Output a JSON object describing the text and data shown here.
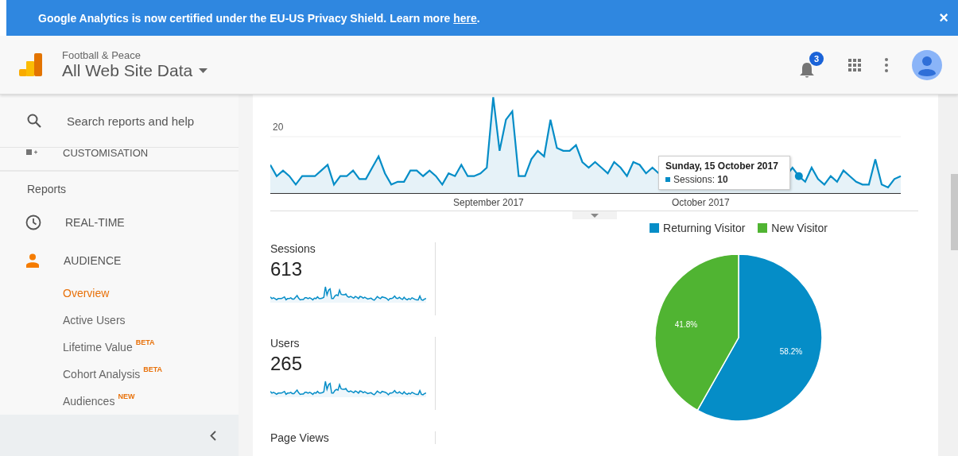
{
  "banner": {
    "message": "Google Analytics is now certified under the EU-US Privacy Shield. Learn more ",
    "link": "here",
    "end": ".",
    "close": "×"
  },
  "header": {
    "account": "Football & Peace",
    "view": "All Web Site Data",
    "notifications": "3"
  },
  "sidebar": {
    "search": {
      "placeholder": "Search reports and help"
    },
    "customisation": "CUSTOMISATION",
    "section": "Reports",
    "items": [
      {
        "label": "REAL-TIME",
        "kind": "clock",
        "selected": false
      },
      {
        "label": "AUDIENCE",
        "kind": "person",
        "selected": true
      }
    ],
    "subitems": [
      {
        "label": "Overview",
        "selected": true
      },
      {
        "label": "Active Users",
        "selected": false
      },
      {
        "label": "Lifetime Value",
        "badge": "BETA",
        "selected": false
      },
      {
        "label": "Cohort Analysis",
        "badge": "BETA",
        "selected": false
      },
      {
        "label": "Audiences",
        "badge": "NEW",
        "selected": false
      }
    ]
  },
  "trend": {
    "ytick": "20",
    "xlabels": [
      "September 2017",
      "October 2017"
    ],
    "tooltip": {
      "date": "Sunday, 15 October 2017",
      "metric": "Sessions: ",
      "value": "10"
    }
  },
  "metrics": [
    {
      "label": "Sessions",
      "value": "613"
    },
    {
      "label": "Users",
      "value": "265"
    },
    {
      "label": "Page Views"
    }
  ],
  "pie": {
    "chart_data": {
      "type": "pie",
      "categories": [
        "Returning Visitor",
        "New Visitor"
      ],
      "values": [
        58.2,
        41.8
      ],
      "colors": [
        "#058dc7",
        "#50b432"
      ],
      "value_labels": [
        "58.2%",
        "41.8%"
      ],
      "legend": true
    }
  }
}
